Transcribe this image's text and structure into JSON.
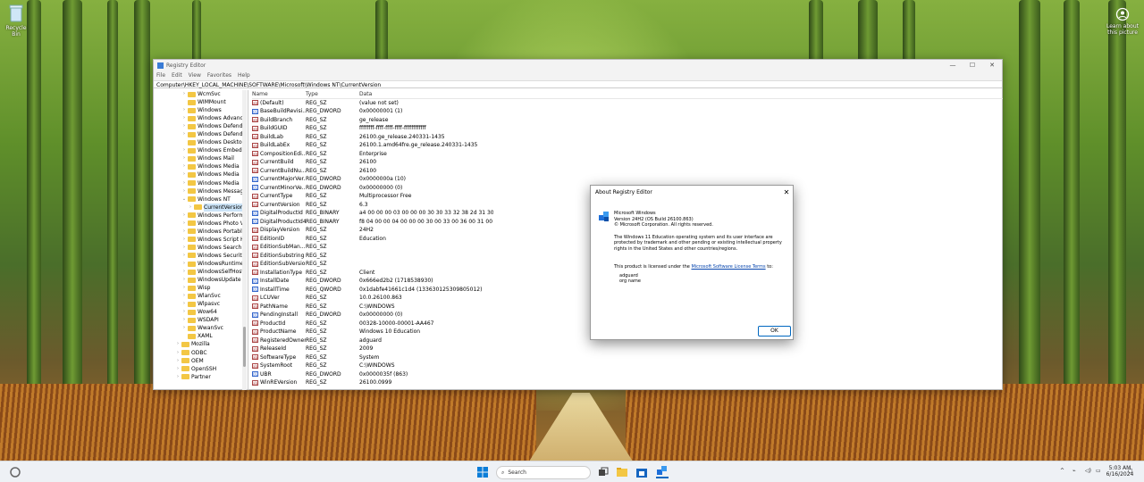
{
  "desktop": {
    "recycle_bin": "Recycle Bin",
    "learn": [
      "Learn about",
      "this picture"
    ]
  },
  "window": {
    "title": "Registry Editor",
    "menu": [
      "File",
      "Edit",
      "View",
      "Favorites",
      "Help"
    ],
    "address": "Computer\\HKEY_LOCAL_MACHINE\\SOFTWARE\\Microsoft\\Windows NT\\CurrentVersion",
    "controls": {
      "minimize": "—",
      "maximize": "☐",
      "close": "✕"
    }
  },
  "tree": [
    {
      "label": "WcmSvc",
      "depth": 2,
      "exp": "›"
    },
    {
      "label": "WIMMount",
      "depth": 2,
      "exp": ""
    },
    {
      "label": "Windows",
      "depth": 2,
      "exp": "›"
    },
    {
      "label": "Windows Advanc",
      "depth": 2,
      "exp": "›"
    },
    {
      "label": "Windows Defend",
      "depth": 2,
      "exp": "›"
    },
    {
      "label": "Windows Defend",
      "depth": 2,
      "exp": "›"
    },
    {
      "label": "Windows Deskto",
      "depth": 2,
      "exp": ""
    },
    {
      "label": "Windows Embed",
      "depth": 2,
      "exp": "›"
    },
    {
      "label": "Windows Mail",
      "depth": 2,
      "exp": "›"
    },
    {
      "label": "Windows Media",
      "depth": 2,
      "exp": "›"
    },
    {
      "label": "Windows Media",
      "depth": 2,
      "exp": "›"
    },
    {
      "label": "Windows Media",
      "depth": 2,
      "exp": "›"
    },
    {
      "label": "Windows Messag",
      "depth": 2,
      "exp": "›"
    },
    {
      "label": "Windows NT",
      "depth": 2,
      "exp": "⌄"
    },
    {
      "label": "CurrentVersion",
      "depth": 3,
      "exp": "›",
      "selected": true
    },
    {
      "label": "Windows Perform",
      "depth": 2,
      "exp": "›"
    },
    {
      "label": "Windows Photo V",
      "depth": 2,
      "exp": "›"
    },
    {
      "label": "Windows Portabl",
      "depth": 2,
      "exp": "›"
    },
    {
      "label": "Windows Script H",
      "depth": 2,
      "exp": "›"
    },
    {
      "label": "Windows Search",
      "depth": 2,
      "exp": "›"
    },
    {
      "label": "Windows Securit",
      "depth": 2,
      "exp": "›"
    },
    {
      "label": "WindowsRuntime",
      "depth": 2,
      "exp": "›"
    },
    {
      "label": "WindowsSelfHost",
      "depth": 2,
      "exp": "›"
    },
    {
      "label": "WindowsUpdate",
      "depth": 2,
      "exp": "›"
    },
    {
      "label": "Wisp",
      "depth": 2,
      "exp": "›"
    },
    {
      "label": "WlanSvc",
      "depth": 2,
      "exp": "›"
    },
    {
      "label": "Wlpasvc",
      "depth": 2,
      "exp": "›"
    },
    {
      "label": "Wow64",
      "depth": 2,
      "exp": "›"
    },
    {
      "label": "WSDAPI",
      "depth": 2,
      "exp": "›"
    },
    {
      "label": "WwanSvc",
      "depth": 2,
      "exp": "›"
    },
    {
      "label": "XAML",
      "depth": 2,
      "exp": ""
    },
    {
      "label": "Mozilla",
      "depth": 1,
      "exp": "›"
    },
    {
      "label": "ODBC",
      "depth": 1,
      "exp": "›"
    },
    {
      "label": "OEM",
      "depth": 1,
      "exp": "›"
    },
    {
      "label": "OpenSSH",
      "depth": 1,
      "exp": "›"
    },
    {
      "label": "Partner",
      "depth": 1,
      "exp": "›"
    }
  ],
  "columns": [
    "Name",
    "Type",
    "Data"
  ],
  "values": [
    {
      "name": "(Default)",
      "type": "REG_SZ",
      "data": "(value not set)",
      "kind": "sz"
    },
    {
      "name": "BaseBuildRevisi...",
      "type": "REG_DWORD",
      "data": "0x00000001 (1)",
      "kind": "bin"
    },
    {
      "name": "BuildBranch",
      "type": "REG_SZ",
      "data": "ge_release",
      "kind": "sz"
    },
    {
      "name": "BuildGUID",
      "type": "REG_SZ",
      "data": "ffffffff-ffff-ffff-ffff-ffffffffffff",
      "kind": "sz"
    },
    {
      "name": "BuildLab",
      "type": "REG_SZ",
      "data": "26100.ge_release.240331-1435",
      "kind": "sz"
    },
    {
      "name": "BuildLabEx",
      "type": "REG_SZ",
      "data": "26100.1.amd64fre.ge_release.240331-1435",
      "kind": "sz"
    },
    {
      "name": "CompositionEdi...",
      "type": "REG_SZ",
      "data": "Enterprise",
      "kind": "sz"
    },
    {
      "name": "CurrentBuild",
      "type": "REG_SZ",
      "data": "26100",
      "kind": "sz"
    },
    {
      "name": "CurrentBuildNu...",
      "type": "REG_SZ",
      "data": "26100",
      "kind": "sz"
    },
    {
      "name": "CurrentMajorVer...",
      "type": "REG_DWORD",
      "data": "0x0000000a (10)",
      "kind": "bin"
    },
    {
      "name": "CurrentMinorVe...",
      "type": "REG_DWORD",
      "data": "0x00000000 (0)",
      "kind": "bin"
    },
    {
      "name": "CurrentType",
      "type": "REG_SZ",
      "data": "Multiprocessor Free",
      "kind": "sz"
    },
    {
      "name": "CurrentVersion",
      "type": "REG_SZ",
      "data": "6.3",
      "kind": "sz"
    },
    {
      "name": "DigitalProductId",
      "type": "REG_BINARY",
      "data": "a4 00 00 00 03 00 00 00 30 30 33 32 38 2d 31 30 30 3...",
      "kind": "bin"
    },
    {
      "name": "DigitalProductId4",
      "type": "REG_BINARY",
      "data": "f8 04 00 00 04 00 00 00 30 00 33 00 36 00 31 00 32 00...",
      "kind": "bin"
    },
    {
      "name": "DisplayVersion",
      "type": "REG_SZ",
      "data": "24H2",
      "kind": "sz"
    },
    {
      "name": "EditionID",
      "type": "REG_SZ",
      "data": "Education",
      "kind": "sz"
    },
    {
      "name": "EditionSubMan...",
      "type": "REG_SZ",
      "data": "",
      "kind": "sz"
    },
    {
      "name": "EditionSubstring",
      "type": "REG_SZ",
      "data": "",
      "kind": "sz"
    },
    {
      "name": "EditionSubVersion",
      "type": "REG_SZ",
      "data": "",
      "kind": "sz"
    },
    {
      "name": "InstallationType",
      "type": "REG_SZ",
      "data": "Client",
      "kind": "sz"
    },
    {
      "name": "InstallDate",
      "type": "REG_DWORD",
      "data": "0x666ed2b2 (1718538930)",
      "kind": "bin"
    },
    {
      "name": "InstallTime",
      "type": "REG_QWORD",
      "data": "0x1dabfe41661c1d4 (133630125309805012)",
      "kind": "bin"
    },
    {
      "name": "LCUVer",
      "type": "REG_SZ",
      "data": "10.0.26100.863",
      "kind": "sz"
    },
    {
      "name": "PathName",
      "type": "REG_SZ",
      "data": "C:\\WINDOWS",
      "kind": "sz"
    },
    {
      "name": "PendingInstall",
      "type": "REG_DWORD",
      "data": "0x00000000 (0)",
      "kind": "bin"
    },
    {
      "name": "ProductId",
      "type": "REG_SZ",
      "data": "00328-10000-00001-AA467",
      "kind": "sz"
    },
    {
      "name": "ProductName",
      "type": "REG_SZ",
      "data": "Windows 10 Education",
      "kind": "sz"
    },
    {
      "name": "RegisteredOwner",
      "type": "REG_SZ",
      "data": "adguard",
      "kind": "sz"
    },
    {
      "name": "ReleaseId",
      "type": "REG_SZ",
      "data": "2009",
      "kind": "sz"
    },
    {
      "name": "SoftwareType",
      "type": "REG_SZ",
      "data": "System",
      "kind": "sz"
    },
    {
      "name": "SystemRoot",
      "type": "REG_SZ",
      "data": "C:\\WINDOWS",
      "kind": "sz"
    },
    {
      "name": "UBR",
      "type": "REG_DWORD",
      "data": "0x0000035f (863)",
      "kind": "bin"
    },
    {
      "name": "WinREVersion",
      "type": "REG_SZ",
      "data": "26100.0999",
      "kind": "sz"
    }
  ],
  "about": {
    "title": "About Registry Editor",
    "product": "Microsoft Windows",
    "version": "Version 24H2 (OS Build 26100.863)",
    "copyright": "© Microsoft Corporation. All rights reserved.",
    "legal": "The Windows 11 Education operating system and its user interface are protected by trademark and other pending or existing intellectual property rights in the United States and other countries/regions.",
    "license_pre": "This product is licensed under the ",
    "license_link": "Microsoft Software License Terms",
    "license_post": " to:",
    "owner": "adguard",
    "org": "org name",
    "ok": "OK"
  },
  "taskbar": {
    "search_placeholder": "Search",
    "time": "5:03 AM",
    "date": "6/16/2024",
    "tray_chevron": "^"
  },
  "colors": {
    "accent": "#0067c0",
    "folder": "#f3c744"
  }
}
